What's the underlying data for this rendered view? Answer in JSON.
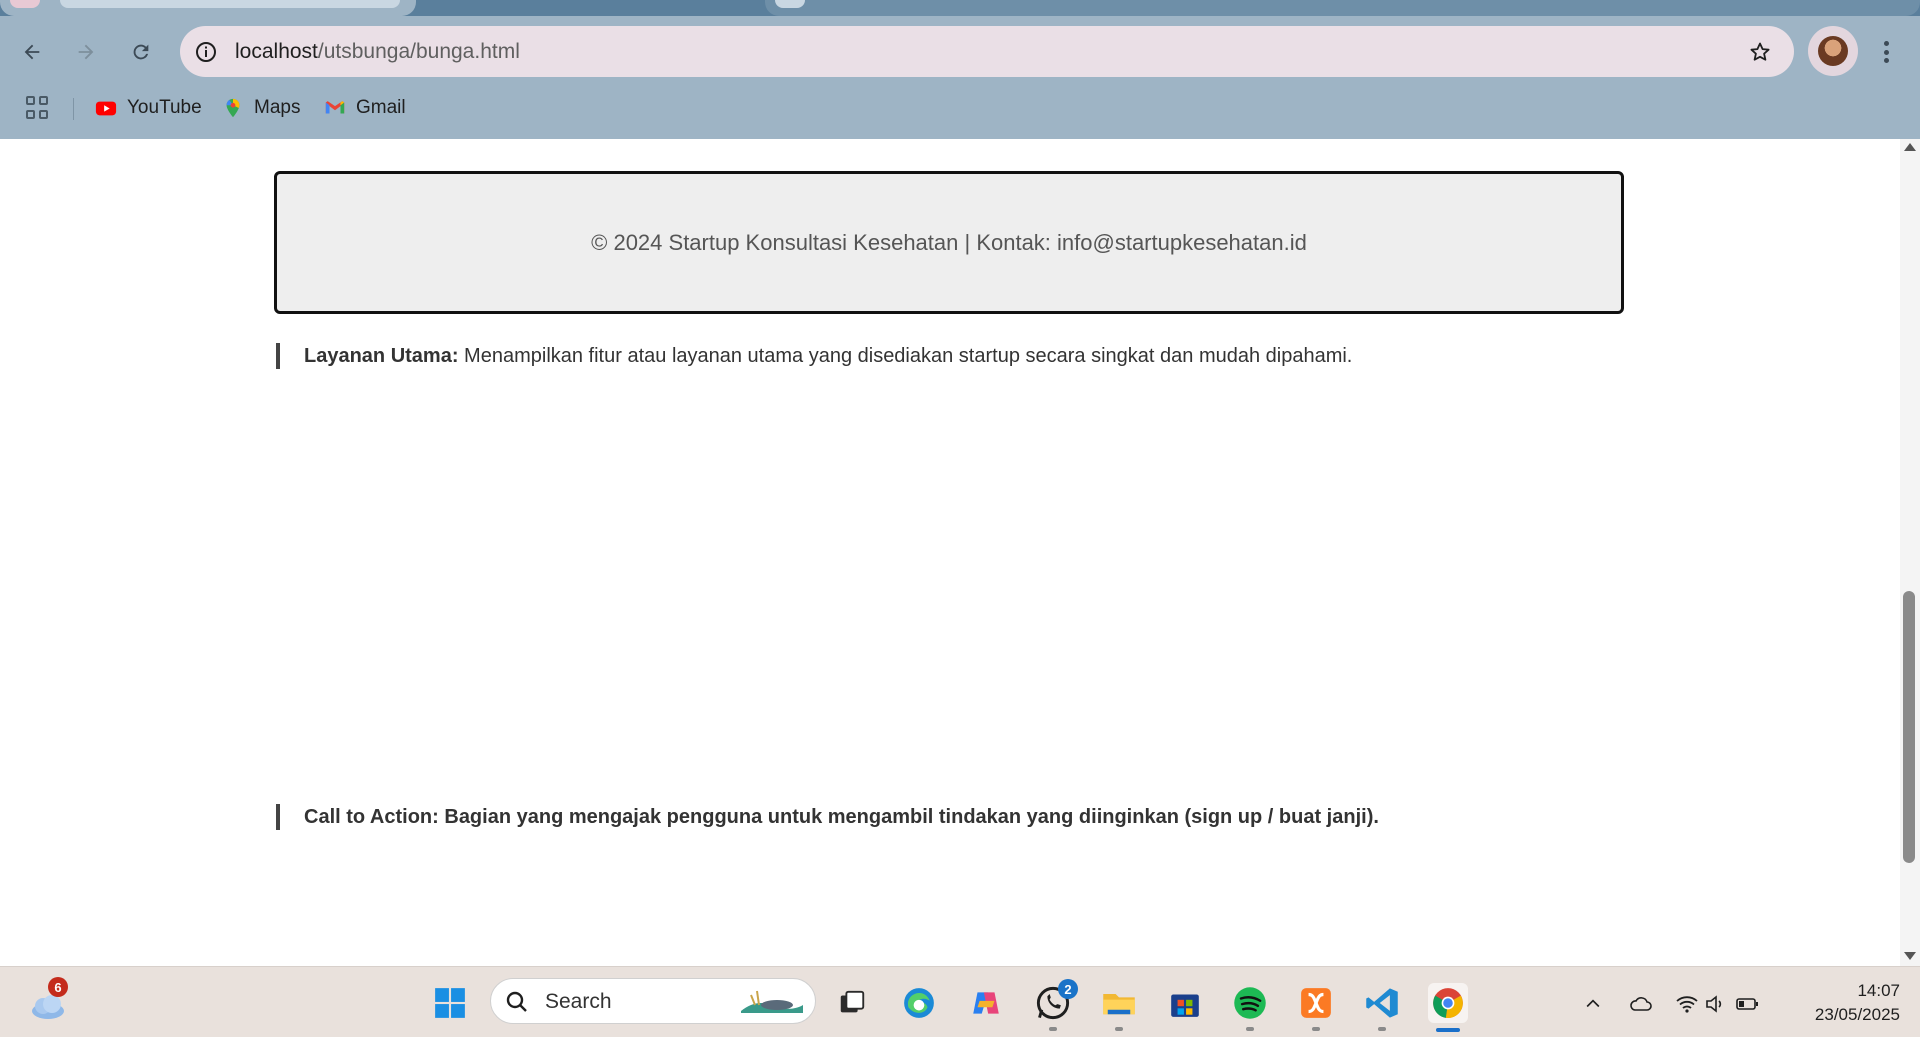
{
  "browser": {
    "url_host": "localhost",
    "url_path": "/utsbunga/bunga.html",
    "bookmarks": [
      {
        "label": "YouTube",
        "icon": "youtube-icon"
      },
      {
        "label": "Maps",
        "icon": "maps-icon"
      },
      {
        "label": "Gmail",
        "icon": "gmail-icon"
      }
    ]
  },
  "page": {
    "footer_text": "© 2024 Startup Konsultasi Kesehatan | Kontak: info@startupkesehatan.id",
    "notes": [
      {
        "title": "Layanan Utama:",
        "body": " Menampilkan fitur atau layanan utama yang disediakan startup secara singkat dan mudah dipahami."
      },
      {
        "title": "Call to Action:",
        "body": " Bagian yang mengajak pengguna untuk mengambil tindakan yang diinginkan (sign up / buat janji)."
      }
    ]
  },
  "taskbar": {
    "weather_badge": "6",
    "search_label": "Search",
    "whatsapp_badge": "2",
    "time": "14:07",
    "date": "23/05/2025"
  },
  "colors": {
    "chrome_bg": "#9eb4c5",
    "omnibox_bg": "#eadfe6",
    "taskbar_bg": "#e9e1dc",
    "footer_box_bg": "#eeeeee"
  }
}
